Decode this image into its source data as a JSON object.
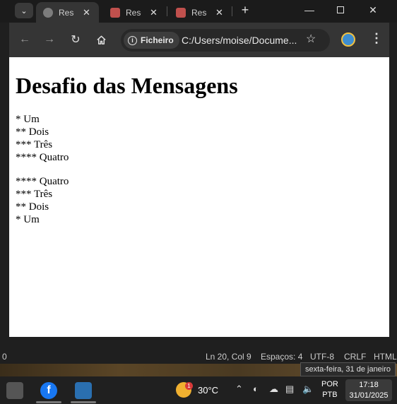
{
  "tabs": [
    {
      "label": "Reso",
      "active": true
    },
    {
      "label": "Reso",
      "active": false
    },
    {
      "label": "Reso",
      "active": false
    }
  ],
  "toolbar": {
    "site_chip": "Ficheiro",
    "url": "C:/Users/moise/Docume..."
  },
  "page": {
    "heading": "Desafio das Mensagens",
    "list_asc": [
      "* Um",
      "** Dois",
      "*** Três",
      "**** Quatro"
    ],
    "list_desc": [
      "**** Quatro",
      "*** Três",
      "** Dois",
      "* Um"
    ]
  },
  "statusbar": {
    "left": "0",
    "position": "Ln 20, Col 9",
    "spaces": "Espaços: 4",
    "encoding": "UTF-8",
    "eol": "CRLF",
    "language": "HTML"
  },
  "tooltip": "sexta-feira, 31 de janeiro",
  "taskbar": {
    "temperature": "30°C",
    "weather_badge": "1",
    "lang_top": "POR",
    "lang_bottom": "PTB",
    "time": "17:18",
    "date": "31/01/2025"
  },
  "icons": [
    "chevron-down-icon",
    "globe-icon",
    "gift-icon",
    "close-icon",
    "plus-icon",
    "minimize-icon",
    "maximize-icon",
    "back-icon",
    "forward-icon",
    "reload-icon",
    "home-icon",
    "info-icon",
    "star-icon",
    "menu-icon",
    "facebook-icon",
    "weather-icon",
    "wifi-icon",
    "volume-muted-icon"
  ]
}
